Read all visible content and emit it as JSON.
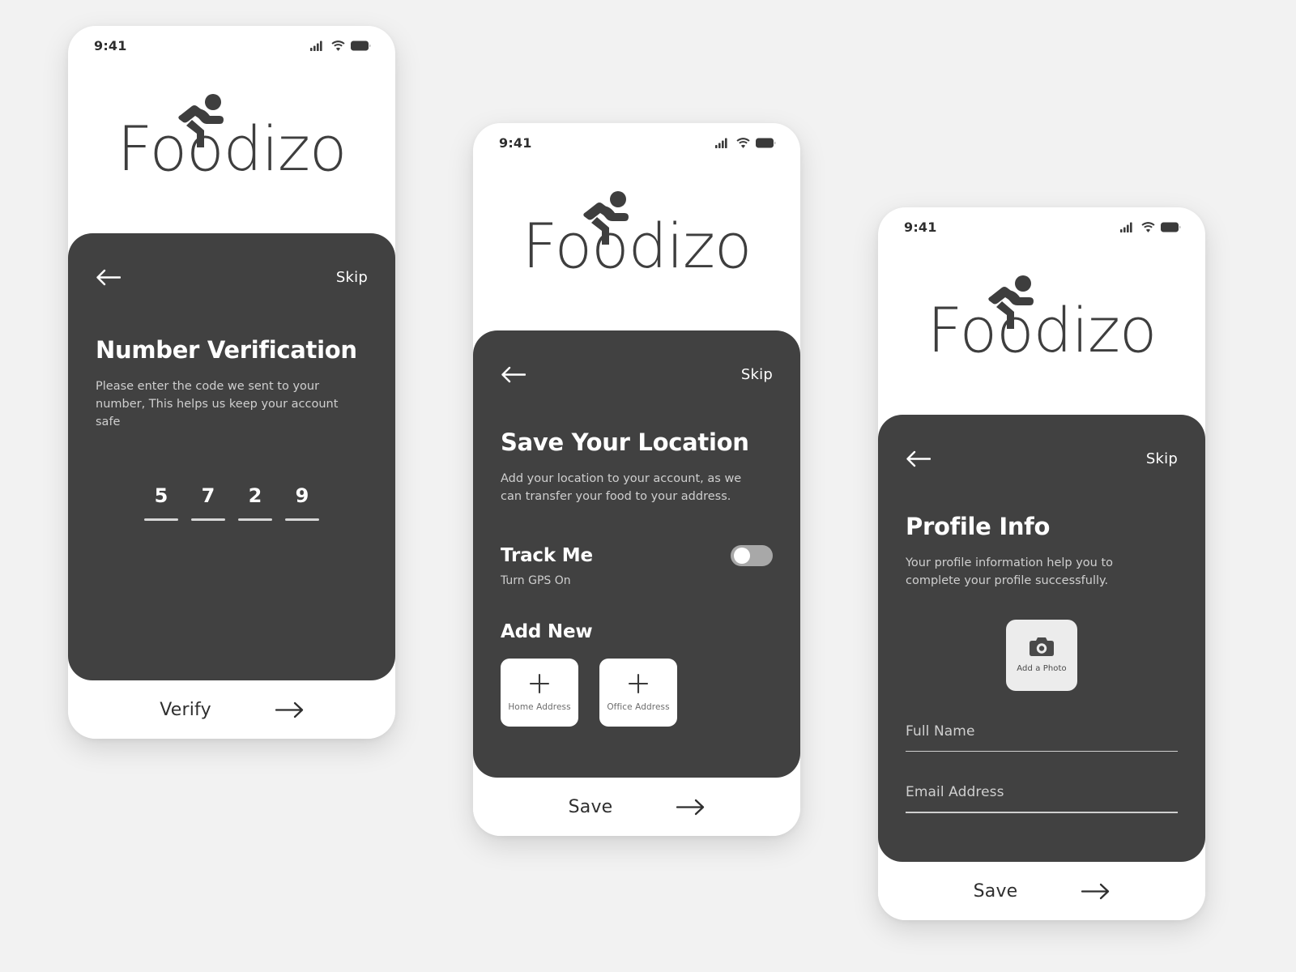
{
  "brand": {
    "name": "Foodizo",
    "logo_icon": "cyclist-delivery-icon",
    "card_color": "#414141",
    "page_background": "#f2f2f2"
  },
  "status_bar": {
    "time": "9:41",
    "icons": [
      "cellular-signal-icon",
      "wifi-icon",
      "battery-icon"
    ]
  },
  "screens": [
    {
      "id": "number-verification",
      "back_icon": "arrow-left-icon",
      "skip_label": "Skip",
      "title": "Number Verification",
      "subtitle": "Please enter the code we sent to your number, This helps us keep your account safe",
      "otp": {
        "digits": [
          "5",
          "7",
          "2",
          "9"
        ]
      },
      "action": {
        "label": "Verify",
        "icon": "arrow-right-icon"
      }
    },
    {
      "id": "save-your-location",
      "back_icon": "arrow-left-icon",
      "skip_label": "Skip",
      "title": "Save Your Location",
      "subtitle": "Add your location to your account, as we can transfer your food to your address.",
      "track_me": {
        "title": "Track Me",
        "subtitle": "Turn GPS On",
        "toggle_state": "off"
      },
      "add_new": {
        "title": "Add New",
        "cards": [
          {
            "label": "Home Address",
            "icon": "plus-icon"
          },
          {
            "label": "Office Address",
            "icon": "plus-icon"
          }
        ]
      },
      "action": {
        "label": "Save",
        "icon": "arrow-right-icon"
      }
    },
    {
      "id": "profile-info",
      "back_icon": "arrow-left-icon",
      "skip_label": "Skip",
      "title": "Profile Info",
      "subtitle": "Your profile information help you to complete your profile successfully.",
      "photo": {
        "label": "Add a Photo",
        "icon": "camera-icon"
      },
      "fields": [
        {
          "label": "Full Name",
          "value": ""
        },
        {
          "label": "Email Address",
          "value": ""
        }
      ],
      "action": {
        "label": "Save",
        "icon": "arrow-right-icon"
      }
    }
  ]
}
